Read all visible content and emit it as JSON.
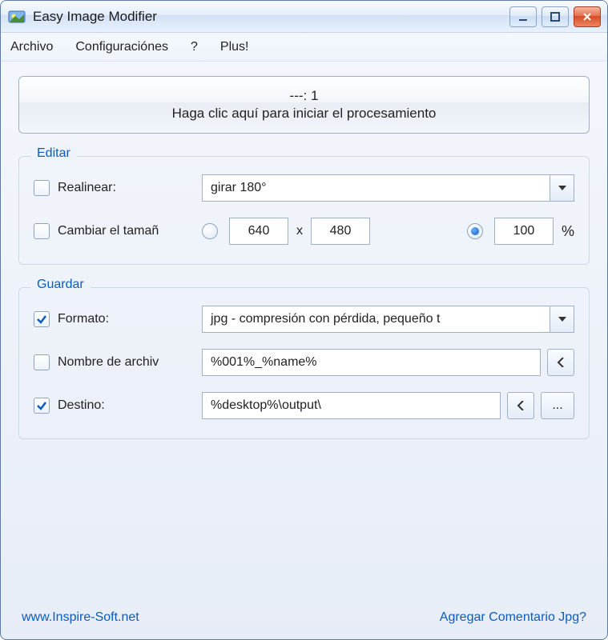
{
  "window": {
    "title": "Easy Image Modifier"
  },
  "menu": {
    "file": "Archivo",
    "settings": "Configuraciónes",
    "help": "?",
    "plus": "Plus!"
  },
  "main_button": {
    "line1": "---: 1",
    "line2": "Haga clic aquí para iniciar el procesamiento"
  },
  "edit_group": {
    "title": "Editar",
    "realign": {
      "checked": false,
      "label": "Realinear:",
      "value": "girar 180°"
    },
    "resize": {
      "checked": false,
      "label": "Cambiar el tamañ",
      "abs_selected": false,
      "width": "640",
      "height": "480",
      "mult": "x",
      "pct_selected": true,
      "percent": "100",
      "pct_symbol": "%"
    }
  },
  "save_group": {
    "title": "Guardar",
    "format": {
      "checked": true,
      "label": "Formato:",
      "value": "jpg - compresión con pérdida, pequeño t"
    },
    "filename": {
      "checked": false,
      "label": "Nombre de archiv",
      "value": "%001%_%name%"
    },
    "dest": {
      "checked": true,
      "label": "Destino:",
      "value": "%desktop%\\output\\",
      "browse": "..."
    }
  },
  "footer": {
    "link": "www.Inspire-Soft.net",
    "comment": "Agregar Comentario Jpg?"
  }
}
